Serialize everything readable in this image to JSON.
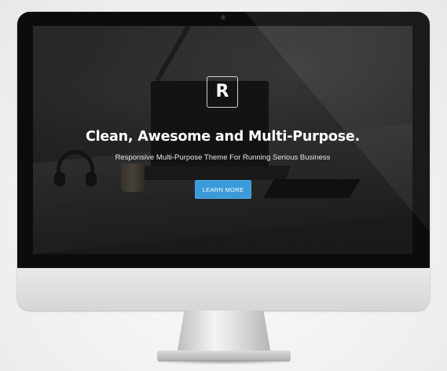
{
  "hero": {
    "logo_letter": "R",
    "headline": "Clean, Awesome and Multi-Purpose.",
    "subheadline": "Responsive Multi-Purpose Theme For Running Serious Business",
    "cta_label": "LEARN MORE"
  },
  "colors": {
    "cta_background": "#3b9ad9",
    "monitor_bezel": "#0c0c0c",
    "monitor_body": "#e0e0e0"
  },
  "icons": {
    "logo": "letter-r-logo-icon",
    "camera": "camera-icon"
  }
}
